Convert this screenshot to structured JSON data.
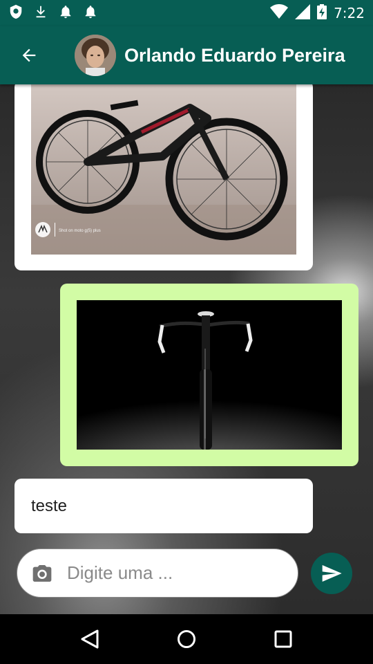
{
  "status_bar": {
    "time": "7:22",
    "left_icons": [
      "shield-icon",
      "download-icon",
      "bell-icon",
      "bell-icon"
    ],
    "right_icons": [
      "wifi-icon",
      "signal-icon",
      "battery-charging-icon"
    ]
  },
  "app_bar": {
    "contact_name": "Orlando Eduardo Pereira",
    "background_color": "#075e54"
  },
  "messages": [
    {
      "type": "image",
      "direction": "received",
      "image": "mountain-bike-photo",
      "watermark": "Shot on moto g(5) plus"
    },
    {
      "type": "image",
      "direction": "sent",
      "image": "road-bike-photo",
      "bubble_color": "#d2fca5"
    },
    {
      "type": "text",
      "direction": "received",
      "text": "teste"
    }
  ],
  "composer": {
    "placeholder": "Digite uma ...",
    "value": ""
  },
  "nav_bar": {
    "buttons": [
      "back-triangle-icon",
      "home-circle-icon",
      "recents-square-icon"
    ]
  }
}
